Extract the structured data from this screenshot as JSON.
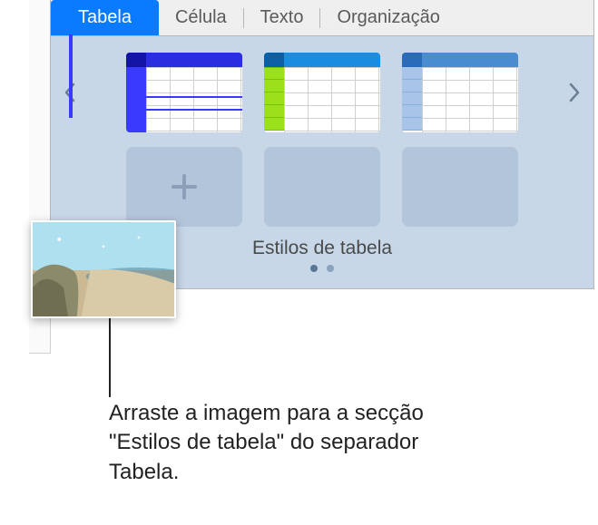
{
  "tabs": {
    "table": "Tabela",
    "cell": "Célula",
    "text": "Texto",
    "arrange": "Organização"
  },
  "styles": {
    "section_label": "Estilos de tabela",
    "items": [
      {
        "name": "style-blue-active"
      },
      {
        "name": "style-green"
      },
      {
        "name": "style-lightblue"
      }
    ]
  },
  "callout": {
    "text": "Arraste a imagem para a secção \"Estilos de tabela\" do separador Tabela."
  },
  "drag_image": {
    "desc": "beach-photo"
  }
}
